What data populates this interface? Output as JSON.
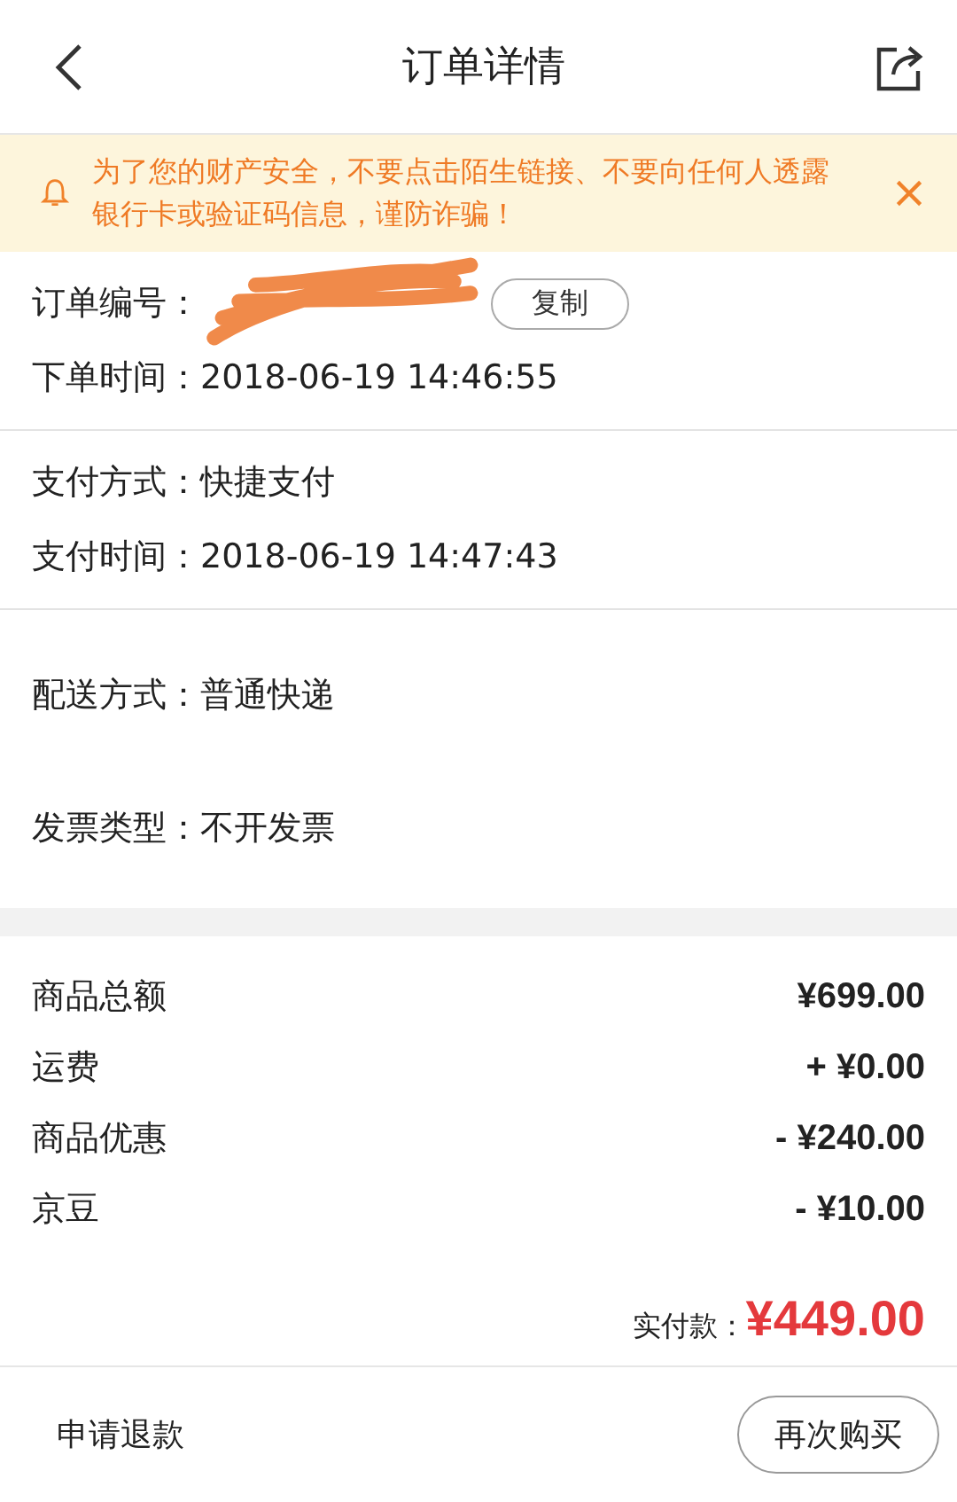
{
  "header": {
    "title": "订单详情"
  },
  "notice": {
    "text": "为了您的财产安全，不要点击陌生链接、不要向任何人透露银行卡或验证码信息，谨防诈骗！"
  },
  "order": {
    "number_label": "订单编号：",
    "number_redacted": true,
    "copy_button": "复制",
    "time_label": "下单时间：",
    "time": "2018-06-19 14:46:55"
  },
  "payment": [
    {
      "label": "支付方式：",
      "value": "快捷支付"
    },
    {
      "label": "支付时间：",
      "value": "2018-06-19 14:47:43"
    }
  ],
  "delivery": {
    "label": "配送方式：",
    "value": "普通快递"
  },
  "invoice": {
    "label": "发票类型：",
    "value": "不开发票"
  },
  "amounts": [
    {
      "label": "商品总额",
      "value": "¥699.00"
    },
    {
      "label": "运费",
      "value": "+ ¥0.00"
    },
    {
      "label": "商品优惠",
      "value": "- ¥240.00"
    },
    {
      "label": "京豆",
      "value": "- ¥10.00"
    }
  ],
  "total": {
    "label": "实付款：",
    "value": "¥449.00"
  },
  "footer": {
    "refund": "申请退款",
    "rebuy": "再次购买"
  }
}
